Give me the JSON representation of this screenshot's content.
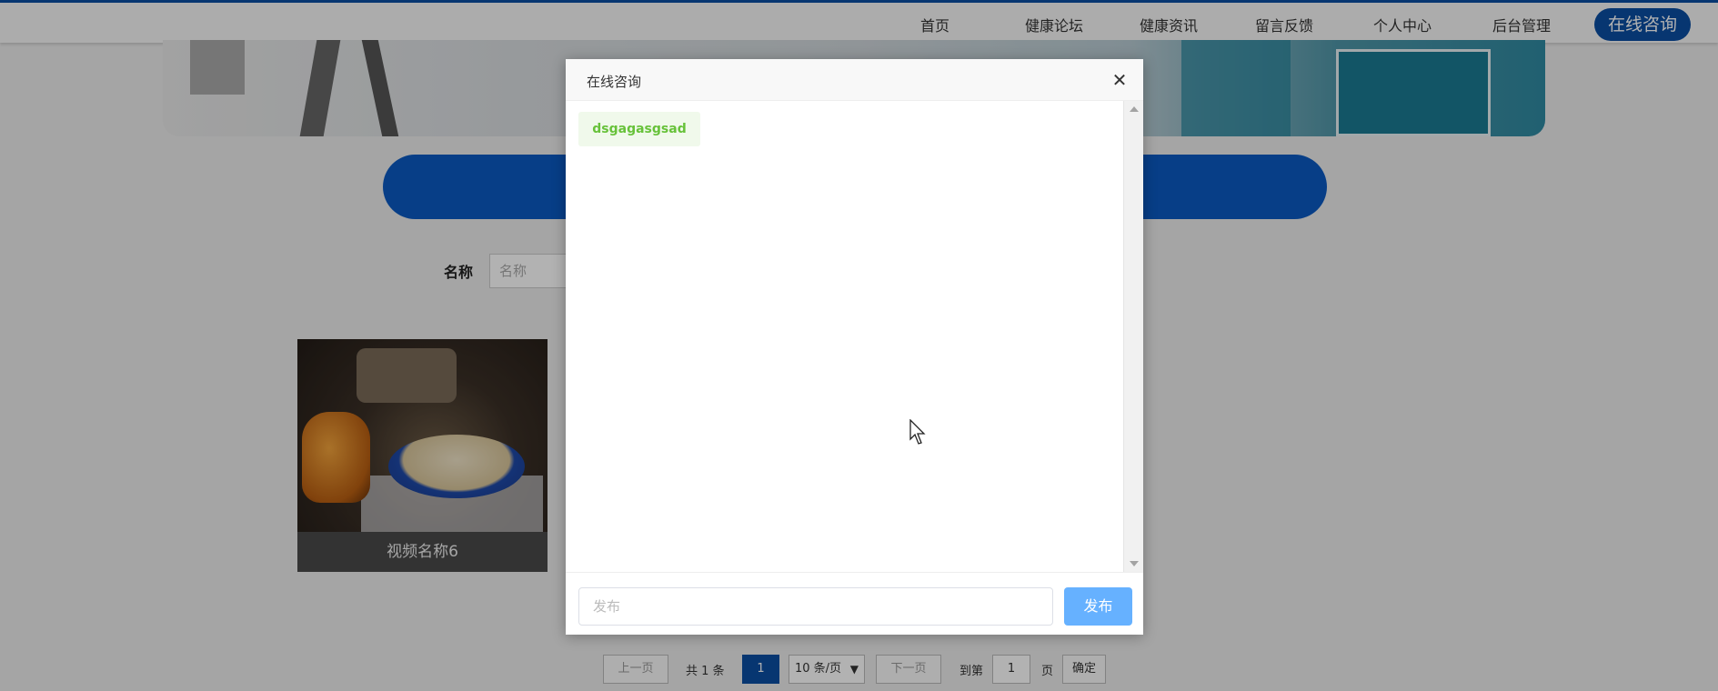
{
  "nav": {
    "items": [
      "首页",
      "健康论坛",
      "健康资讯",
      "留言反馈",
      "个人中心",
      "后台管理"
    ],
    "consult": "在线咨询"
  },
  "search": {
    "label": "名称",
    "placeholder": "名称"
  },
  "card": {
    "title": "视频名称6"
  },
  "pagination": {
    "prev": "上一页",
    "total": "共 1 条",
    "current": "1",
    "page_size": "10 条/页",
    "next": "下一页",
    "goto_prefix": "到第",
    "goto_value": "1",
    "goto_suffix": "页",
    "confirm": "确定"
  },
  "dialog": {
    "title": "在线咨询",
    "close_icon": "close-icon",
    "messages": [
      "dsgagasgsad"
    ],
    "input_placeholder": "发布",
    "send_label": "发布"
  },
  "colors": {
    "primary": "#0b4ea2",
    "send_button": "#66b1ff",
    "bubble_bg": "#f0f9eb",
    "bubble_text": "#67c23a"
  }
}
